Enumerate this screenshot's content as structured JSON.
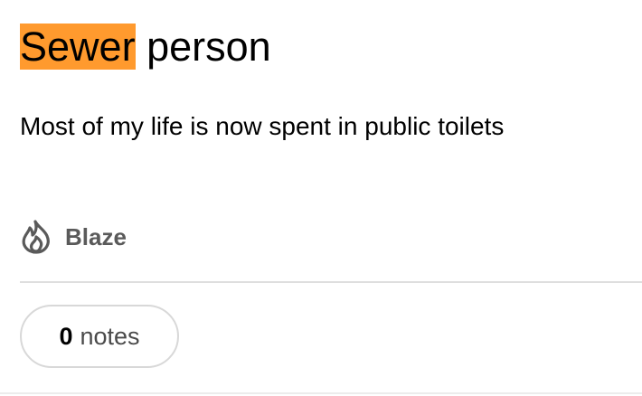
{
  "post": {
    "title_highlight": "Sewer",
    "title_rest": " person",
    "body": "Most of my life is now spent in public toilets",
    "blaze": {
      "icon": "flame-icon",
      "label": "Blaze"
    },
    "notes": {
      "count": "0",
      "label": "notes"
    }
  },
  "colors": {
    "highlight": "#ff9a2e",
    "muted_text": "#5a5a5a",
    "divider": "#dedede"
  }
}
